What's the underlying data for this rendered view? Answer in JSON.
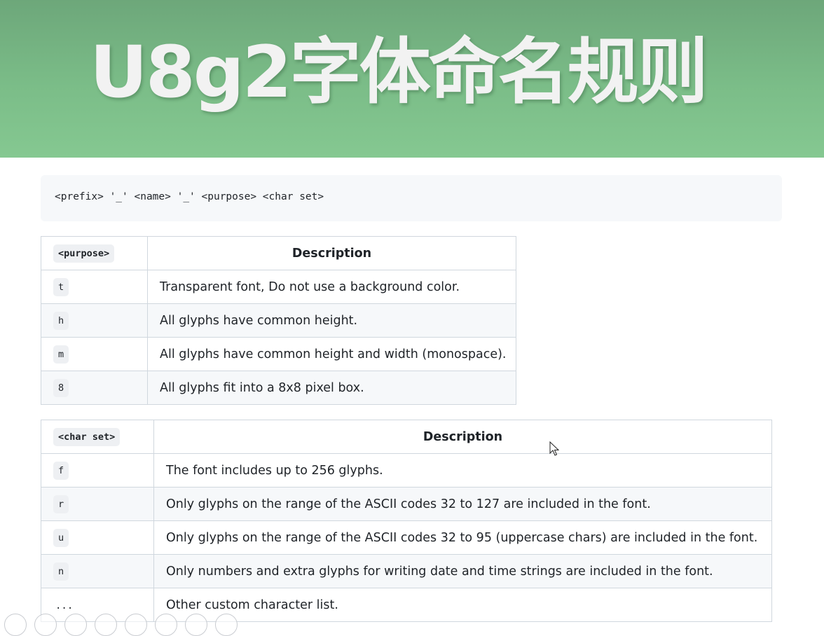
{
  "banner": {
    "title": "U8g2字体命名规则"
  },
  "syntax": {
    "code": "<prefix> '_' <name> '_' <purpose> <char set>"
  },
  "purpose_table": {
    "header_key": "<purpose>",
    "header_desc": "Description",
    "rows": [
      {
        "key": "t",
        "desc": "Transparent font, Do not use a background color."
      },
      {
        "key": "h",
        "desc": "All glyphs have common height."
      },
      {
        "key": "m",
        "desc": "All glyphs have common height and width (monospace)."
      },
      {
        "key": "8",
        "desc": "All glyphs fit into a 8x8 pixel box."
      }
    ]
  },
  "charset_table": {
    "header_key": "<char set>",
    "header_desc": "Description",
    "rows": [
      {
        "key": "f",
        "desc": "The font includes up to 256 glyphs."
      },
      {
        "key": "r",
        "desc": "Only glyphs on the range of the ASCII codes 32 to 127 are included in the font."
      },
      {
        "key": "u",
        "desc": "Only glyphs on the range of the ASCII codes 32 to 95 (uppercase chars) are included in the font."
      },
      {
        "key": "n",
        "desc": "Only numbers and extra glyphs for writing date and time strings are included in the font."
      },
      {
        "key": "...",
        "desc": "Other custom character list."
      }
    ]
  },
  "icons": {
    "cursor": "mouse-pointer-icon",
    "taskbar": [
      "back-icon",
      "pointer-icon",
      "pen-icon",
      "save-icon",
      "search-icon",
      "window-icon",
      "image-icon",
      "more-icon"
    ]
  }
}
